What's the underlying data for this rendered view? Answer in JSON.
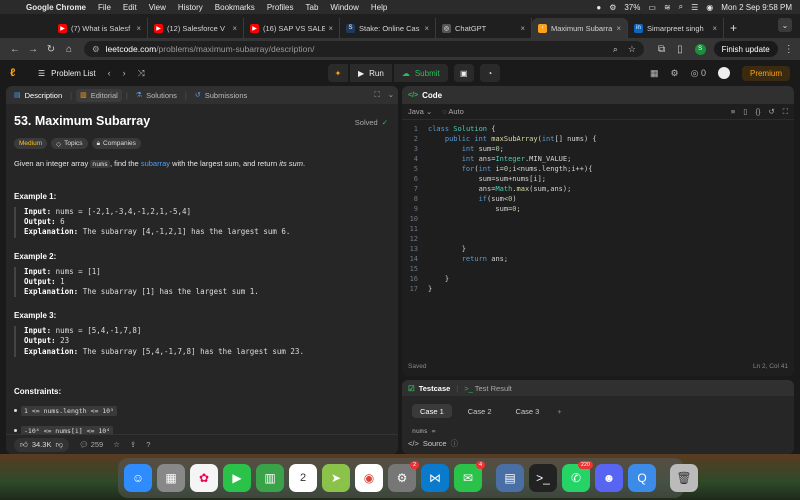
{
  "menubar": {
    "app": "Google Chrome",
    "items": [
      "File",
      "Edit",
      "View",
      "History",
      "Bookmarks",
      "Profiles",
      "Tab",
      "Window",
      "Help"
    ],
    "battery": "37%",
    "datetime": "Mon 2 Sep 9:58 PM"
  },
  "tabs": [
    {
      "title": "(7) What is Salesf",
      "color": "#ff0000",
      "glyph": "▶"
    },
    {
      "title": "(12) Salesforce V",
      "color": "#ff0000",
      "glyph": "▶"
    },
    {
      "title": "(16) SAP VS SALE",
      "color": "#ff0000",
      "glyph": "▶"
    },
    {
      "title": "Stake: Online Cas",
      "color": "#1e3a5f",
      "glyph": "S"
    },
    {
      "title": "ChatGPT",
      "color": "#555555",
      "glyph": "◎"
    },
    {
      "title": "Maximum Subarra",
      "color": "#ffa116",
      "glyph": "‹"
    },
    {
      "title": "Simarpreet singh",
      "color": "#0a66c2",
      "glyph": "in"
    }
  ],
  "address": {
    "host": "leetcode.com",
    "path": "/problems/maximum-subarray/description/",
    "profile_initial": "S",
    "finish_update": "Finish update"
  },
  "lc_top": {
    "problem_list": "Problem List",
    "run": "Run",
    "submit": "Submit",
    "streak": "0",
    "premium": "Premium"
  },
  "left_tabs": {
    "description": "Description",
    "editorial": "Editorial",
    "solutions": "Solutions",
    "submissions": "Submissions"
  },
  "problem": {
    "title": "53. Maximum Subarray",
    "status": "Solved",
    "difficulty": "Medium",
    "topics": "Topics",
    "companies": "Companies",
    "desc_pre": "Given an integer array ",
    "desc_code": "nums",
    "desc_mid": ", find the ",
    "desc_link": "subarray",
    "desc_post": " with the largest sum, and return ",
    "desc_em": "its sum",
    "desc_end": ".",
    "examples": [
      {
        "title": "Example 1:",
        "input": "nums = [-2,1,-3,4,-1,2,1,-5,4]",
        "output": "6",
        "explanation": "The subarray [4,-1,2,1] has the largest sum 6."
      },
      {
        "title": "Example 2:",
        "input": "nums = [1]",
        "output": "1",
        "explanation": "The subarray [1] has the largest sum 1."
      },
      {
        "title": "Example 3:",
        "input": "nums = [5,4,-1,7,8]",
        "output": "23",
        "explanation": "The subarray [5,4,-1,7,8] has the largest sum 23."
      }
    ],
    "labels": {
      "input": "Input:",
      "output": "Output:",
      "explanation": "Explanation:"
    },
    "constraints_title": "Constraints:",
    "constraints": [
      "1 <= nums.length <= 10⁵",
      "-10⁴ <= nums[i] <= 10⁴"
    ],
    "likes": "34.3K",
    "comments": "259"
  },
  "code": {
    "header": "Code",
    "language": "Java",
    "mode": "Auto",
    "saved": "Saved",
    "cursor": "Ln 2, Col 41"
  },
  "test": {
    "testcase": "Testcase",
    "result": "Test Result",
    "cases": [
      "Case 1",
      "Case 2",
      "Case 3"
    ],
    "nums_label": "nums =",
    "source": "Source"
  }
}
